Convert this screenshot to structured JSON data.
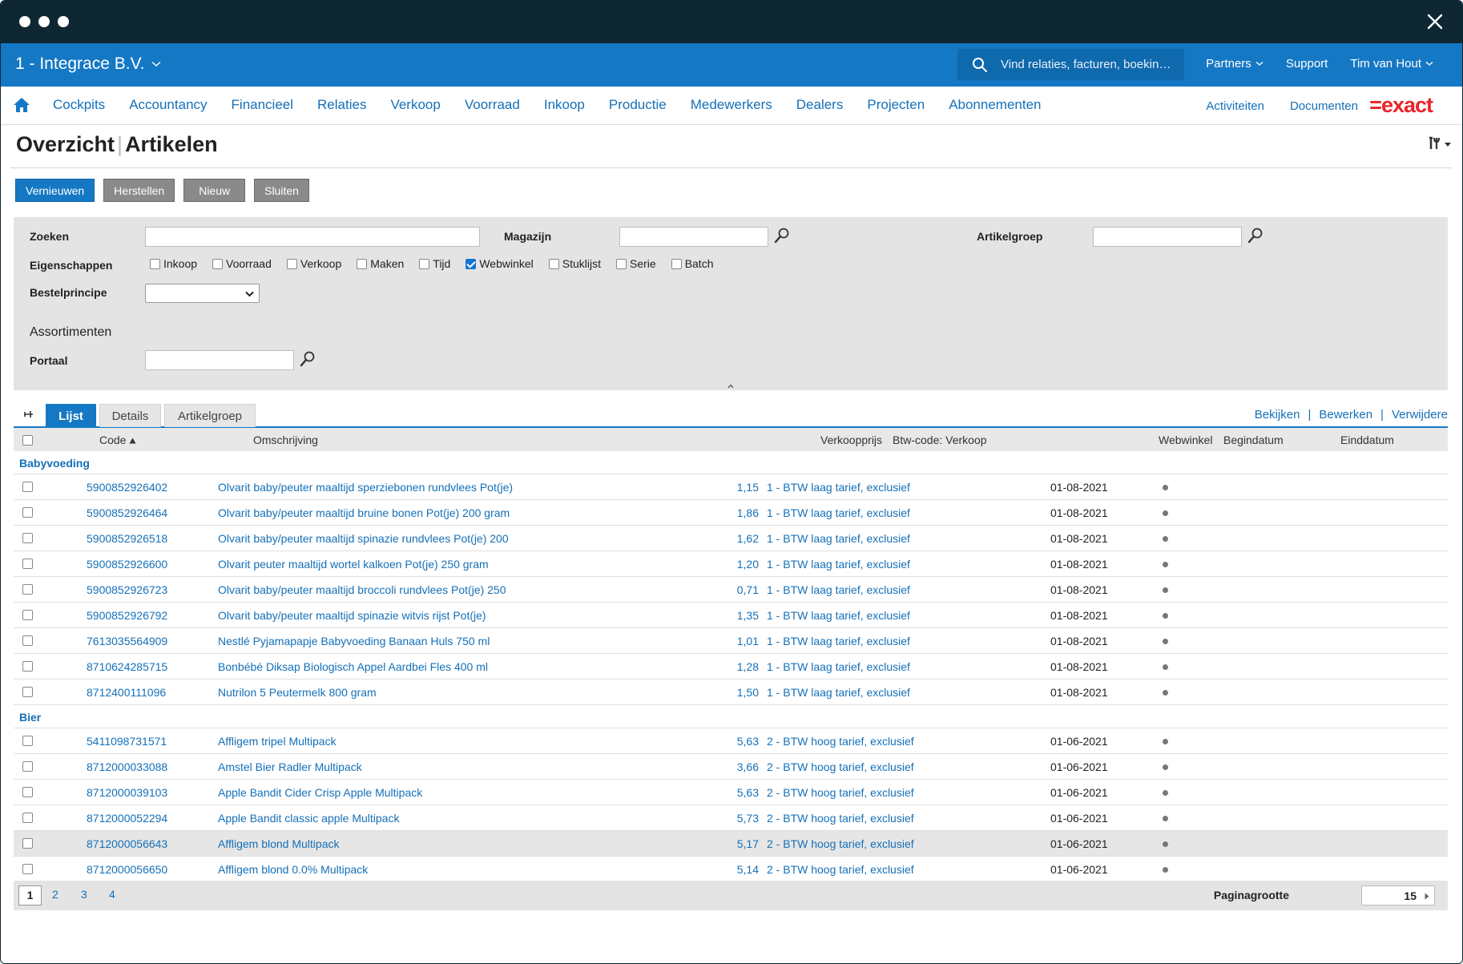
{
  "window": {
    "close_label": "×"
  },
  "topbar": {
    "company": "1 - Integrace B.V.",
    "search_placeholder": "Vind relaties, facturen, boekin…",
    "partners": "Partners",
    "support": "Support",
    "user": "Tim van Hout"
  },
  "nav": {
    "items": [
      "Cockpits",
      "Accountancy",
      "Financieel",
      "Relaties",
      "Verkoop",
      "Voorraad",
      "Inkoop",
      "Productie",
      "Medewerkers",
      "Dealers",
      "Projecten",
      "Abonnementen"
    ],
    "activiteiten": "Activiteiten",
    "documenten": "Documenten",
    "logo": "=exact"
  },
  "page": {
    "title_part1": "Overzicht",
    "title_sep": "|",
    "title_part2": "Artikelen"
  },
  "buttons": {
    "vernieuwen": "Vernieuwen",
    "herstellen": "Herstellen",
    "nieuw": "Nieuw",
    "sluiten": "Sluiten"
  },
  "filter": {
    "zoeken": "Zoeken",
    "magazijn": "Magazijn",
    "artikelgroep": "Artikelgroep",
    "eigenschappen": "Eigenschappen",
    "bestelprincipe": "Bestelprincipe",
    "assortimenten": "Assortimenten",
    "portaal": "Portaal",
    "checks": [
      {
        "label": "Inkoop",
        "checked": false
      },
      {
        "label": "Voorraad",
        "checked": false
      },
      {
        "label": "Verkoop",
        "checked": false
      },
      {
        "label": "Maken",
        "checked": false
      },
      {
        "label": "Tijd",
        "checked": false
      },
      {
        "label": "Webwinkel",
        "checked": true
      },
      {
        "label": "Stuklijst",
        "checked": false
      },
      {
        "label": "Serie",
        "checked": false
      },
      {
        "label": "Batch",
        "checked": false
      }
    ]
  },
  "tabs": {
    "lijst": "Lijst",
    "details": "Details",
    "artikelgroep": "Artikelgroep"
  },
  "actions": {
    "bekijken": "Bekijken",
    "bewerken": "Bewerken",
    "verwijderen": "Verwijdere",
    "sep": "|"
  },
  "table": {
    "headers": {
      "code": "Code",
      "omschrijving": "Omschrijving",
      "verkoopprijs": "Verkoopprijs",
      "btw": "Btw-code: Verkoop",
      "webwinkel": "Webwinkel",
      "begindatum": "Begindatum",
      "einddatum": "Einddatum"
    },
    "groups": [
      {
        "name": "Babyvoeding",
        "rows": [
          {
            "code": "5900852926402",
            "omschrijving": "Olvarit baby/peuter maaltijd sperziebonen rundvlees Pot(je)",
            "prijs": "1,15",
            "btw": "1 - BTW laag tarief, exclusief",
            "begin": "01-08-2021"
          },
          {
            "code": "5900852926464",
            "omschrijving": "Olvarit baby/peuter maaltijd bruine bonen Pot(je) 200 gram",
            "prijs": "1,86",
            "btw": "1 - BTW laag tarief, exclusief",
            "begin": "01-08-2021"
          },
          {
            "code": "5900852926518",
            "omschrijving": "Olvarit baby/peuter maaltijd spinazie rundvlees Pot(je) 200",
            "prijs": "1,62",
            "btw": "1 - BTW laag tarief, exclusief",
            "begin": "01-08-2021"
          },
          {
            "code": "5900852926600",
            "omschrijving": "Olvarit peuter maaltijd wortel kalkoen Pot(je) 250 gram",
            "prijs": "1,20",
            "btw": "1 - BTW laag tarief, exclusief",
            "begin": "01-08-2021"
          },
          {
            "code": "5900852926723",
            "omschrijving": "Olvarit baby/peuter maaltijd broccoli rundvlees Pot(je) 250",
            "prijs": "0,71",
            "btw": "1 - BTW laag tarief, exclusief",
            "begin": "01-08-2021"
          },
          {
            "code": "5900852926792",
            "omschrijving": "Olvarit baby/peuter maaltijd spinazie witvis rijst Pot(je)",
            "prijs": "1,35",
            "btw": "1 - BTW laag tarief, exclusief",
            "begin": "01-08-2021"
          },
          {
            "code": "7613035564909",
            "omschrijving": "Nestlé Pyjamapapje Babyvoeding Banaan Huls 750 ml",
            "prijs": "1,01",
            "btw": "1 - BTW laag tarief, exclusief",
            "begin": "01-08-2021"
          },
          {
            "code": "8710624285715",
            "omschrijving": "Bonbébé Diksap Biologisch Appel Aardbei Fles 400 ml",
            "prijs": "1,28",
            "btw": "1 - BTW laag tarief, exclusief",
            "begin": "01-08-2021"
          },
          {
            "code": "8712400111096",
            "omschrijving": "Nutrilon 5 Peutermelk 800 gram",
            "prijs": "1,50",
            "btw": "1 - BTW laag tarief, exclusief",
            "begin": "01-08-2021"
          }
        ]
      },
      {
        "name": "Bier",
        "rows": [
          {
            "code": "5411098731571",
            "omschrijving": "Affligem tripel Multipack",
            "prijs": "5,63",
            "btw": "2 - BTW hoog tarief, exclusief",
            "begin": "01-06-2021"
          },
          {
            "code": "8712000033088",
            "omschrijving": "Amstel Bier Radler Multipack",
            "prijs": "3,66",
            "btw": "2 - BTW hoog tarief, exclusief",
            "begin": "01-06-2021"
          },
          {
            "code": "8712000039103",
            "omschrijving": "Apple Bandit Cider Crisp Apple Multipack",
            "prijs": "5,63",
            "btw": "2 - BTW hoog tarief, exclusief",
            "begin": "01-06-2021"
          },
          {
            "code": "8712000052294",
            "omschrijving": "Apple Bandit classic apple Multipack",
            "prijs": "5,73",
            "btw": "2 - BTW hoog tarief, exclusief",
            "begin": "01-06-2021"
          },
          {
            "code": "8712000056643",
            "omschrijving": "Affligem blond Multipack",
            "prijs": "5,17",
            "btw": "2 - BTW hoog tarief, exclusief",
            "begin": "01-06-2021",
            "highlight": true
          },
          {
            "code": "8712000056650",
            "omschrijving": "Affligem blond 0.0% Multipack",
            "prijs": "5,14",
            "btw": "2 - BTW hoog tarief, exclusief",
            "begin": "01-06-2021"
          }
        ]
      }
    ]
  },
  "pager": {
    "pages": [
      "1",
      "2",
      "3",
      "4"
    ],
    "current": "1",
    "size_label": "Paginagrootte",
    "size": "15"
  },
  "colors": {
    "brand": "#1578c4",
    "titlebar": "#0e2733",
    "link": "#1570b8",
    "logo": "#e8242a"
  }
}
